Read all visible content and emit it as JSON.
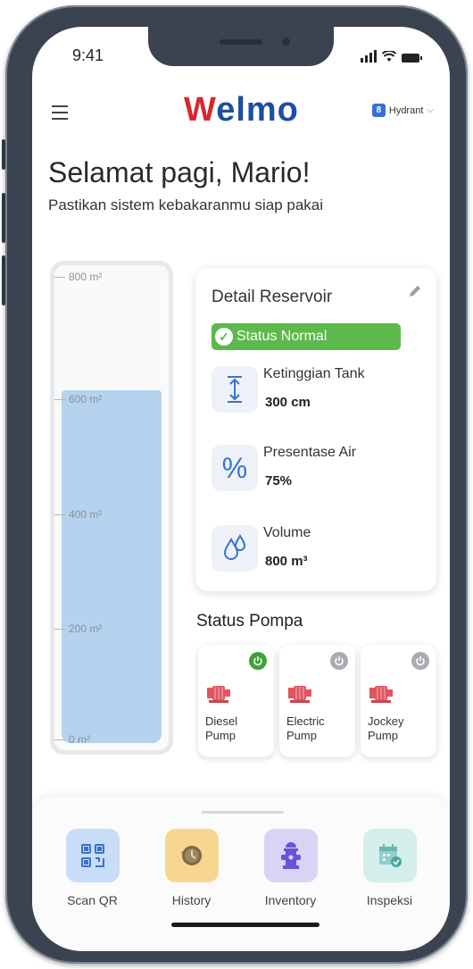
{
  "status_bar": {
    "time": "9:41"
  },
  "header": {
    "logo_first": "W",
    "logo_rest": "elmo",
    "site_badge": "8",
    "site_label": "Hydrant"
  },
  "greeting": {
    "title": "Selamat pagi, Mario!",
    "subtitle": "Pastikan sistem kebakaranmu siap pakai"
  },
  "tank": {
    "fill_fraction": 0.75,
    "ticks": [
      "800 m²",
      "600 m²",
      "400 m²",
      "200 m²",
      "0 m²"
    ]
  },
  "reservoir": {
    "title": "Detail Reservoir",
    "status": "Status Normal",
    "metrics": [
      {
        "icon": "height-icon",
        "label": "Ketinggian Tank",
        "value": "300 cm"
      },
      {
        "icon": "percent-icon",
        "label": "Presentase Air",
        "value": "75%"
      },
      {
        "icon": "water-drop-icon",
        "label": "Volume",
        "value": "800 m³"
      }
    ]
  },
  "pumps": {
    "title": "Status Pompa",
    "items": [
      {
        "name_line1": "Diesel",
        "name_line2": "Pump",
        "active": true
      },
      {
        "name_line1": "Electric",
        "name_line2": "Pump",
        "active": false
      },
      {
        "name_line1": "Jockey",
        "name_line2": "Pump",
        "active": false
      }
    ]
  },
  "nav": {
    "items": [
      {
        "label": "Scan QR",
        "icon": "qr-code-icon",
        "bg": "#c9dcf8"
      },
      {
        "label": "History",
        "icon": "history-icon",
        "bg": "#f7d78f"
      },
      {
        "label": "Inventory",
        "icon": "hydrant-icon",
        "bg": "#d9d3f6"
      },
      {
        "label": "Inspeksi",
        "icon": "calendar-check-icon",
        "bg": "#d4eeec"
      }
    ]
  },
  "colors": {
    "brand_red": "#d9262e",
    "brand_blue": "#1e4e9e",
    "status_green": "#5cb94b",
    "tank_water": "#b5d3ee",
    "power_on": "#3fa33a",
    "power_off": "#a9acb1"
  }
}
